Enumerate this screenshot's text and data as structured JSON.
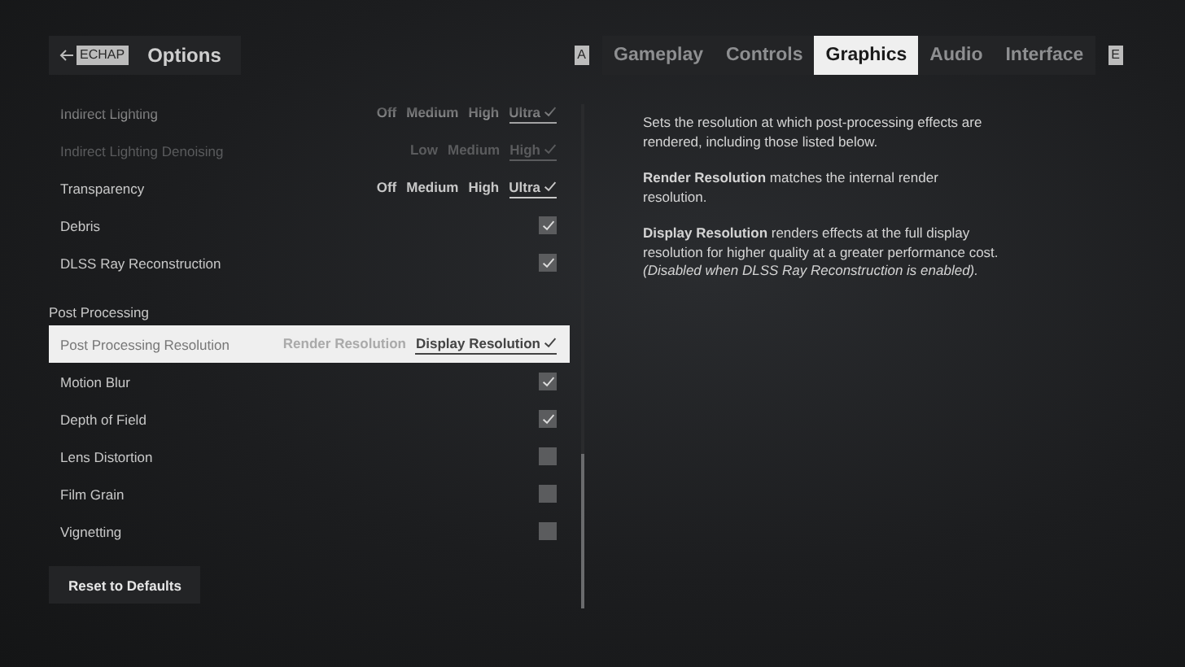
{
  "header": {
    "back_key": "ECHAP",
    "title": "Options"
  },
  "tabs": {
    "prev_key": "A",
    "next_key": "E",
    "items": [
      {
        "label": "Gameplay",
        "selected": false
      },
      {
        "label": "Controls",
        "selected": false
      },
      {
        "label": "Graphics",
        "selected": true
      },
      {
        "label": "Audio",
        "selected": false
      },
      {
        "label": "Interface",
        "selected": false
      }
    ]
  },
  "settings": [
    {
      "kind": "options",
      "label": "Indirect Lighting",
      "disabled": false,
      "highlighted": false,
      "options": [
        {
          "label": "Off",
          "selected": false
        },
        {
          "label": "Medium",
          "selected": false
        },
        {
          "label": "High",
          "selected": false
        },
        {
          "label": "Ultra",
          "selected": true
        }
      ]
    },
    {
      "kind": "options",
      "label": "Indirect Lighting Denoising",
      "disabled": true,
      "highlighted": false,
      "options": [
        {
          "label": "Low",
          "selected": false
        },
        {
          "label": "Medium",
          "selected": false
        },
        {
          "label": "High",
          "selected": true
        }
      ]
    },
    {
      "kind": "options",
      "label": "Transparency",
      "disabled": false,
      "highlighted": false,
      "options": [
        {
          "label": "Off",
          "selected": false
        },
        {
          "label": "Medium",
          "selected": false
        },
        {
          "label": "High",
          "selected": false
        },
        {
          "label": "Ultra",
          "selected": true
        }
      ]
    },
    {
      "kind": "checkbox",
      "label": "Debris",
      "disabled": false,
      "highlighted": false,
      "checked": true
    },
    {
      "kind": "checkbox",
      "label": "DLSS Ray Reconstruction",
      "disabled": false,
      "highlighted": false,
      "checked": true
    },
    {
      "kind": "section",
      "label": "Post Processing"
    },
    {
      "kind": "options",
      "label": "Post Processing Resolution",
      "disabled": false,
      "highlighted": true,
      "options": [
        {
          "label": "Render Resolution",
          "selected": false
        },
        {
          "label": "Display Resolution",
          "selected": true
        }
      ]
    },
    {
      "kind": "checkbox",
      "label": "Motion Blur",
      "disabled": false,
      "highlighted": false,
      "checked": true
    },
    {
      "kind": "checkbox",
      "label": "Depth of Field",
      "disabled": false,
      "highlighted": false,
      "checked": true
    },
    {
      "kind": "checkbox",
      "label": "Lens Distortion",
      "disabled": false,
      "highlighted": false,
      "checked": false
    },
    {
      "kind": "checkbox",
      "label": "Film Grain",
      "disabled": false,
      "highlighted": false,
      "checked": false
    },
    {
      "kind": "checkbox",
      "label": "Vignetting",
      "disabled": false,
      "highlighted": false,
      "checked": false
    }
  ],
  "reset_button": "Reset to Defaults",
  "description": [
    "Sets the resolution at which post-processing effects are rendered, including those listed below.",
    "**Render Resolution** matches the internal render resolution.",
    "**Display Resolution** renders effects at the full display resolution for higher quality at a greater performance cost. *(Disabled when DLSS Ray Reconstruction is enabled).*"
  ]
}
